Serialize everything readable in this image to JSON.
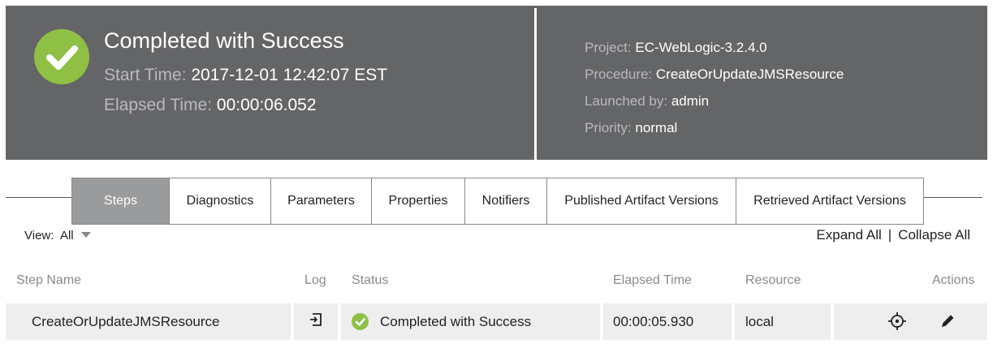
{
  "header": {
    "status": "Completed with Success",
    "start_time_label": "Start Time:",
    "start_time_value": "2017-12-01 12:42:07 EST",
    "elapsed_label": "Elapsed Time:",
    "elapsed_value": "00:00:06.052",
    "project_label": "Project:",
    "project_value": "EC-WebLogic-3.2.4.0",
    "procedure_label": "Procedure:",
    "procedure_value": "CreateOrUpdateJMSResource",
    "launched_label": "Launched by:",
    "launched_value": "admin",
    "priority_label": "Priority:",
    "priority_value": "normal"
  },
  "tabs": [
    {
      "label": "Steps",
      "active": true
    },
    {
      "label": "Diagnostics",
      "active": false
    },
    {
      "label": "Parameters",
      "active": false
    },
    {
      "label": "Properties",
      "active": false
    },
    {
      "label": "Notifiers",
      "active": false
    },
    {
      "label": "Published Artifact Versions",
      "active": false
    },
    {
      "label": "Retrieved Artifact Versions",
      "active": false
    }
  ],
  "view": {
    "label": "View:",
    "value": "All"
  },
  "links": {
    "expand_all": "Expand All",
    "separator": "|",
    "collapse_all": "Collapse All"
  },
  "table": {
    "columns": [
      "Step Name",
      "Log",
      "Status",
      "Elapsed Time",
      "Resource",
      "Actions"
    ],
    "rows": [
      {
        "step_name": "CreateOrUpdateJMSResource",
        "status": "Completed with Success",
        "elapsed": "00:00:05.930",
        "resource": "local"
      }
    ]
  },
  "icons": {
    "status": "success-check-icon",
    "log": "log-file-icon",
    "locate": "crosshair-icon",
    "edit": "pencil-icon"
  },
  "colors": {
    "header_bg": "#646567",
    "success": "#8ec045",
    "active_tab": "#9a9b9d",
    "row_bg": "#eeeeee"
  }
}
